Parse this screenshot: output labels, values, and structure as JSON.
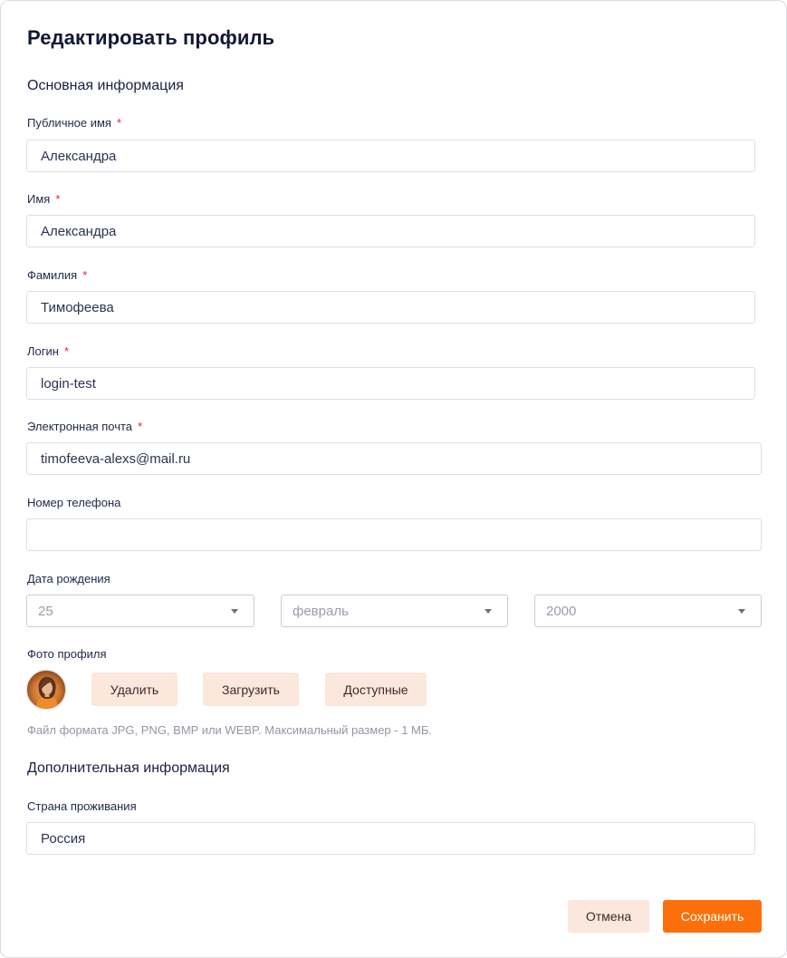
{
  "form": {
    "title": "Редактировать профиль",
    "section_main": "Основная информация",
    "section_extra": "Дополнительная информация"
  },
  "fields": {
    "public_name": {
      "label": "Публичное имя",
      "required": "*",
      "value": "Александра"
    },
    "first_name": {
      "label": "Имя",
      "required": "*",
      "value": "Александра"
    },
    "last_name": {
      "label": "Фамилия",
      "required": "*",
      "value": "Тимофеева"
    },
    "login": {
      "label": "Логин",
      "required": "*",
      "value": "login-test"
    },
    "email": {
      "label": "Электронная почта",
      "required": "*",
      "value": "timofeeva-alexs@mail.ru"
    },
    "phone": {
      "label": "Номер телефона",
      "value": ""
    },
    "birth_date": {
      "label": "Дата рождения",
      "day": "25",
      "month": "февраль",
      "year": "2000"
    },
    "photo": {
      "label": "Фото профиля",
      "delete_label": "Удалить",
      "upload_label": "Загрузить",
      "available_label": "Доступные",
      "hint": "Файл формата JPG, PNG, BMP или WEBP. Максимальный размер - 1 МБ."
    },
    "country": {
      "label": "Страна проживания",
      "value": "Россия"
    }
  },
  "actions": {
    "cancel_label": "Отмена",
    "save_label": "Сохранить"
  },
  "colors": {
    "accent": "#fd6f0a",
    "secondary_button": "#fce7dc",
    "required": "#e0262f"
  },
  "icons": {
    "select_caret": "chevron-down-icon"
  }
}
